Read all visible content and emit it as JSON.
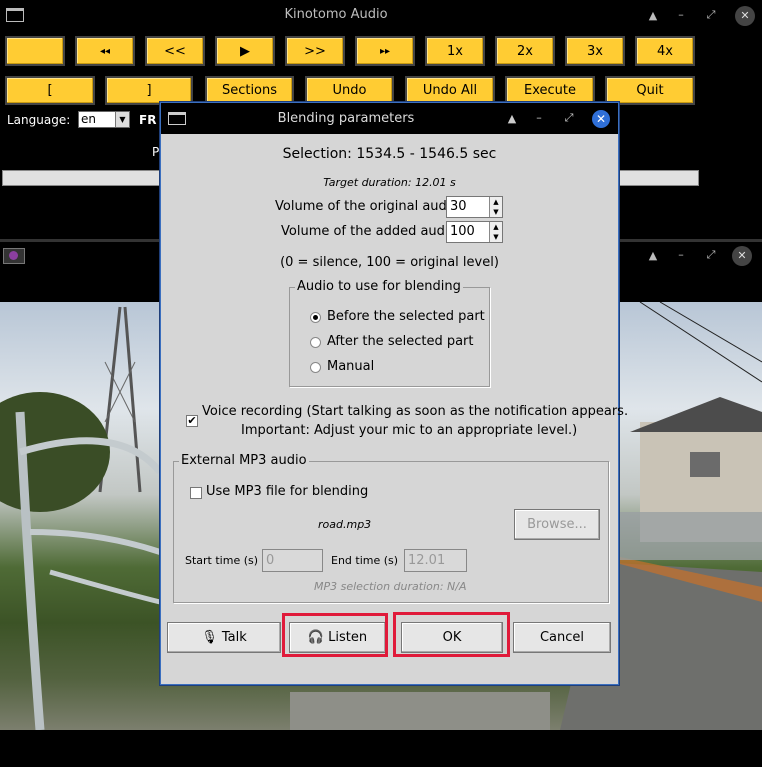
{
  "main_window": {
    "title": "Kinotomo Audio",
    "controls": {
      "shade": "▲",
      "minimize": "–",
      "maximize": "⤢",
      "close": "✕"
    },
    "row1_buttons": [
      "",
      "◂◂",
      "<<",
      "▶",
      ">>",
      "▸▸",
      "1x",
      "2x",
      "3x",
      "4x"
    ],
    "row2_buttons": [
      "[",
      "]",
      "Sections",
      "Undo",
      "Undo All",
      "Execute",
      "Quit"
    ],
    "language_label": "Language:",
    "language_value": "en",
    "fr_label": "FR",
    "p_label": "P",
    "progress_fraction": 0
  },
  "video_window": {
    "controls": {
      "shade": "▲",
      "minimize": "–",
      "maximize": "⤢",
      "close": "✕"
    }
  },
  "dialog": {
    "title": "Blending parameters",
    "controls": {
      "shade": "▲",
      "minimize": "–",
      "maximize": "⤢",
      "close": "✕"
    },
    "selection": "Selection: 1534.5 - 1546.5 sec",
    "target_duration": "Target duration: 12.01 s",
    "volume_original_label": "Volume of the original audio",
    "volume_original_value": "30",
    "volume_added_label": "Volume of the added audio",
    "volume_added_value": "100",
    "volume_hint": "(0 = silence, 100 = original level)",
    "blend_group_label": "Audio to use for blending",
    "blend_options": [
      {
        "label": "Before the selected part",
        "selected": true
      },
      {
        "label": "After the selected part",
        "selected": false
      },
      {
        "label": "Manual",
        "selected": false
      }
    ],
    "voice_recording_line1": "Voice recording (Start talking as soon as the notification appears.",
    "voice_recording_line2": "Important: Adjust your mic to an appropriate level.)",
    "voice_recording_checked": true,
    "mp3_group_label": "External MP3 audio",
    "use_mp3_label": "Use MP3 file for blending",
    "use_mp3_checked": false,
    "mp3_filename": "road.mp3",
    "browse_label": "Browse...",
    "start_time_label": "Start time (s)",
    "start_time_value": "0",
    "end_time_label": "End time (s)",
    "end_time_value": "12.01",
    "mp3_selection_duration": "MP3 selection duration: N/A",
    "talk_label": "Talk",
    "listen_label": "Listen",
    "ok_label": "OK",
    "cancel_label": "Cancel",
    "talk_icon": "microphone-icon",
    "listen_icon": "headphones-icon"
  },
  "colors": {
    "button_yellow": "#ffcc33",
    "highlight_red": "#e01a3a",
    "dialog_bg": "#d6d6d6",
    "close_blue": "#2f6fd8"
  }
}
